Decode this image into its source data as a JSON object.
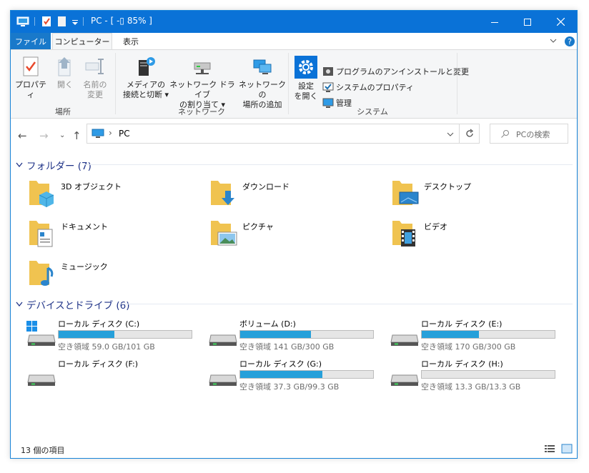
{
  "window": {
    "title": "PC - [ -▯ 85% ]",
    "controls": {
      "minimize": "—",
      "maximize": "☐",
      "close": "✕"
    }
  },
  "ribbon_tabs": {
    "file": "ファイル",
    "computer": "コンピューター",
    "view": "表示"
  },
  "ribbon": {
    "location": {
      "label": "場所",
      "properties": "プロパティ",
      "open": "開く",
      "rename_l1": "名前の",
      "rename_l2": "変更"
    },
    "network": {
      "label": "ネットワーク",
      "media_l1": "メディアの",
      "media_l2": "接続と切断",
      "map_l1": "ネットワーク ドライブ",
      "map_l2": "の割り当て",
      "add_l1": "ネットワークの",
      "add_l2": "場所の追加"
    },
    "system": {
      "label": "システム",
      "settings_l1": "設定",
      "settings_l2": "を開く",
      "uninstall": "プログラムのアンインストールと変更",
      "sysprops": "システムのプロパティ",
      "manage": "管理"
    }
  },
  "address": {
    "path": "PC",
    "search_placeholder": "PCの検索"
  },
  "folders": {
    "header": "フォルダー (7)",
    "items": [
      "3D オブジェクト",
      "ダウンロード",
      "デスクトップ",
      "ドキュメント",
      "ピクチャ",
      "ビデオ",
      "ミュージック"
    ]
  },
  "devices": {
    "header": "デバイスとドライブ (6)",
    "drives": [
      {
        "name": "ローカル ディスク (C:)",
        "free": "空き領域 59.0 GB/101 GB",
        "used_fraction": 0.42,
        "type": "system"
      },
      {
        "name": "ボリューム (D:)",
        "free": "空き領域 141 GB/300 GB",
        "used_fraction": 0.53,
        "type": "hdd"
      },
      {
        "name": "ローカル ディスク (E:)",
        "free": "空き領域 170 GB/300 GB",
        "used_fraction": 0.43,
        "type": "hdd"
      },
      {
        "name": "ローカル ディスク (F:)",
        "free": "",
        "used_fraction": null,
        "type": "hdd"
      },
      {
        "name": "ローカル ディスク (G:)",
        "free": "空き領域 37.3 GB/99.3 GB",
        "used_fraction": 0.62,
        "type": "hdd"
      },
      {
        "name": "ローカル ディスク (H:)",
        "free": "空き領域 13.3 GB/13.3 GB",
        "used_fraction": 0.0,
        "type": "hdd"
      }
    ]
  },
  "status": {
    "count": "13 個の項目"
  },
  "colors": {
    "accent": "#0a72d7",
    "file_tab": "#1979ca",
    "drive_bar": "#26a0da",
    "section_header": "#1e3287"
  }
}
